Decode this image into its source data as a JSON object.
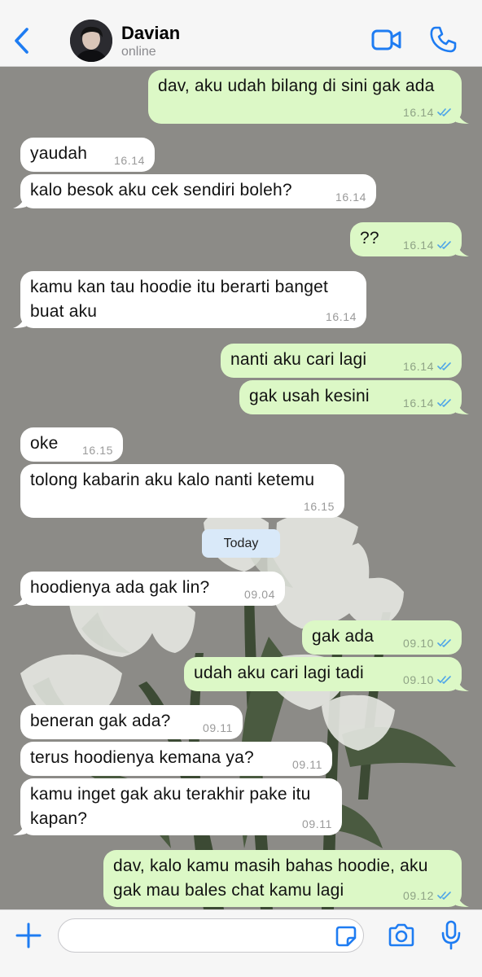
{
  "header": {
    "contact_name": "Davian",
    "status": "online",
    "icons": [
      "back-chevron-icon",
      "video-camera-icon",
      "phone-icon"
    ]
  },
  "chat": {
    "background_color": "#8c8b87",
    "incoming_color": "#ffffff",
    "outgoing_color": "#dcf8c6",
    "tick_color": "#4fa6e8",
    "day_separator": "Today",
    "messages": [
      {
        "dir": "out",
        "text": "dav, aku udah bilang di sini gak ada",
        "time": "16.14"
      },
      {
        "dir": "in",
        "text": "yaudah",
        "time": "16.14"
      },
      {
        "dir": "in",
        "text": "kalo besok aku cek sendiri boleh?",
        "time": "16.14"
      },
      {
        "dir": "out",
        "text": "??",
        "time": "16.14"
      },
      {
        "dir": "in",
        "text": "kamu kan tau hoodie itu berarti banget\nbuat aku",
        "time": "16.14"
      },
      {
        "dir": "out",
        "text": "nanti aku cari lagi",
        "time": "16.14"
      },
      {
        "dir": "out",
        "text": "gak usah kesini",
        "time": "16.14"
      },
      {
        "dir": "in",
        "text": "oke",
        "time": "16.15"
      },
      {
        "dir": "in",
        "text": "tolong kabarin aku kalo nanti ketemu",
        "time": "16.15"
      },
      {
        "dir": "in",
        "text": "hoodienya ada gak lin?",
        "time": "09.04"
      },
      {
        "dir": "out",
        "text": "gak ada",
        "time": "09.10"
      },
      {
        "dir": "out",
        "text": "udah aku cari lagi tadi",
        "time": "09.10"
      },
      {
        "dir": "in",
        "text": "beneran gak ada?",
        "time": "09.11"
      },
      {
        "dir": "in",
        "text": "terus hoodienya kemana ya?",
        "time": "09.11"
      },
      {
        "dir": "in",
        "text": "kamu inget gak aku terakhir pake itu\nkapan?",
        "time": "09.11"
      },
      {
        "dir": "out",
        "text": "dav, kalo kamu masih bahas hoodie, aku\ngak mau bales chat kamu lagi",
        "time": "09.12"
      }
    ]
  },
  "composer": {
    "input_value": "",
    "icons": [
      "plus-icon",
      "sticker-icon",
      "camera-icon",
      "microphone-icon"
    ]
  }
}
